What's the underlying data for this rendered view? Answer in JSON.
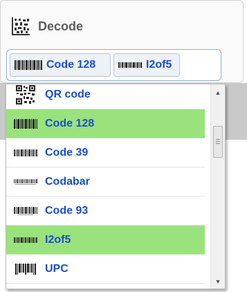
{
  "header": {
    "title": "Decode",
    "icon": "datamatrix-icon"
  },
  "selected": [
    {
      "label": "Code 128",
      "icon": "barcode-icon"
    },
    {
      "label": "I2of5",
      "icon": "barcode-icon"
    }
  ],
  "options": [
    {
      "label": "QR code",
      "icon": "qr-code-icon",
      "selected": false
    },
    {
      "label": "Code 128",
      "icon": "barcode-icon",
      "selected": true
    },
    {
      "label": "Code 39",
      "icon": "barcode-icon",
      "selected": false
    },
    {
      "label": "Codabar",
      "icon": "barcode-icon",
      "selected": false
    },
    {
      "label": "Code 93",
      "icon": "barcode-icon",
      "selected": false
    },
    {
      "label": "I2of5",
      "icon": "barcode-icon",
      "selected": true
    },
    {
      "label": "UPC",
      "icon": "barcode-icon",
      "selected": false
    }
  ],
  "colors": {
    "selected_bg": "#9ae27c",
    "label": "#1a4ec8",
    "title": "#5c5c5c"
  }
}
